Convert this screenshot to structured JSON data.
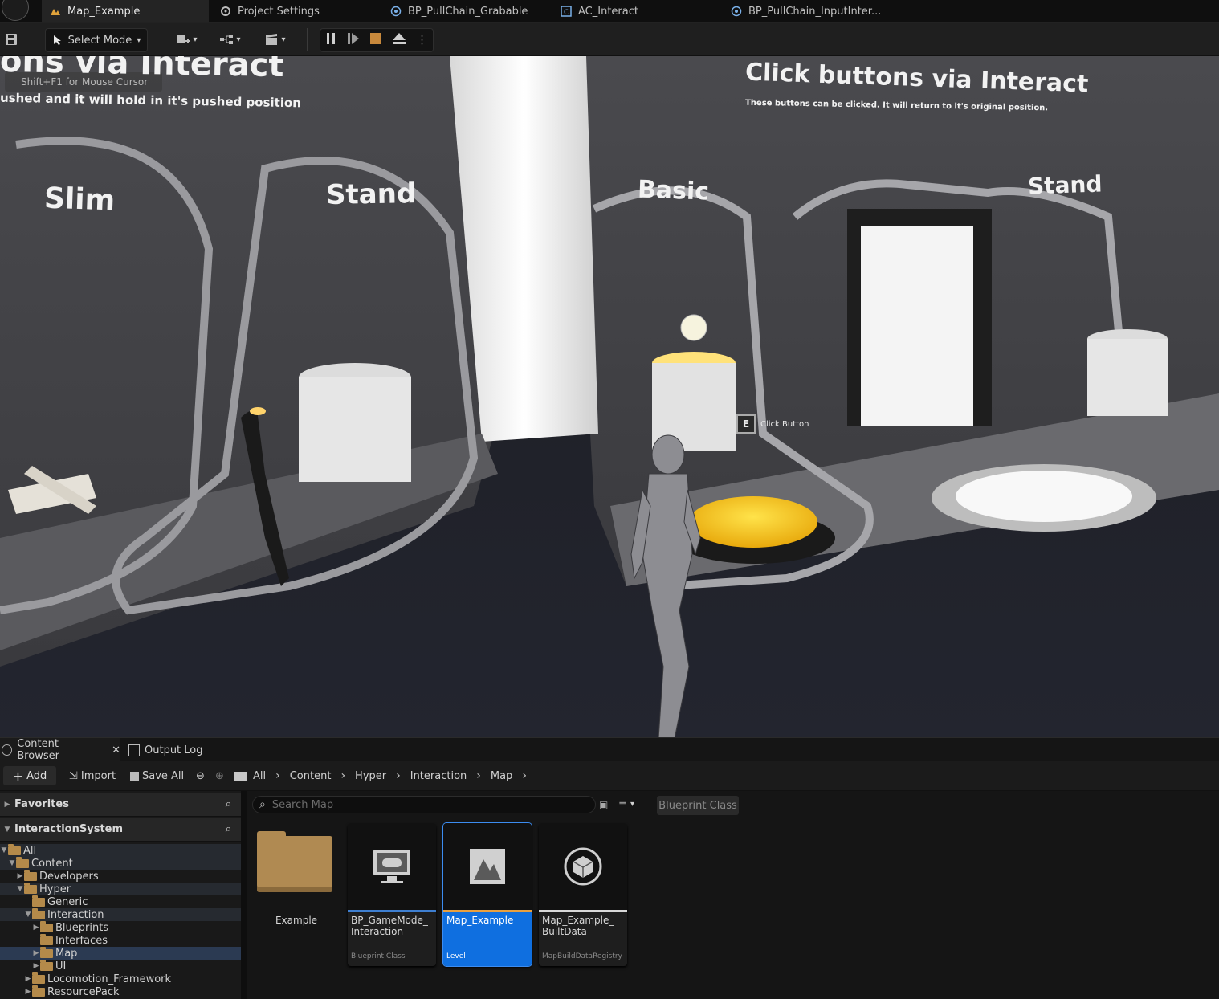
{
  "tabs": [
    {
      "label": "Map_Example",
      "icon": "level-icon",
      "active": true
    },
    {
      "label": "Project Settings",
      "icon": "settings-icon",
      "active": false
    },
    {
      "label": "BP_PullChain_Grabable",
      "icon": "blueprint-icon",
      "active": false
    },
    {
      "label": "AC_Interact",
      "icon": "component-icon",
      "active": false
    },
    {
      "label": "BP_PullChain_InputInter...",
      "icon": "blueprint-icon",
      "active": false
    }
  ],
  "toolbar": {
    "select_mode": "Select Mode"
  },
  "viewport": {
    "cursor_hint": "Shift+F1 for Mouse Cursor",
    "left_heading": "ons via Interact",
    "left_subheading": "ushed and it will hold in it's pushed position",
    "right_heading": "Click buttons via Interact",
    "right_subheading": "These buttons can be clicked. It will return to it's original position.",
    "booths": [
      "Slim",
      "Stand",
      "Basic",
      "Stand"
    ],
    "prompt_key": "E",
    "prompt_text": "Click Button"
  },
  "content_browser": {
    "tab_label": "Content Browser",
    "output_log_label": "Output Log",
    "add_label": "Add",
    "import_label": "Import",
    "save_all_label": "Save All",
    "breadcrumbs": [
      "All",
      "Content",
      "Hyper",
      "Interaction",
      "Map"
    ],
    "favorites_label": "Favorites",
    "project_label": "InteractionSystem",
    "search_placeholder": "Search Map",
    "filter_chip": "Blueprint Class",
    "tree": [
      {
        "label": "All",
        "expanded": true
      },
      {
        "label": "Content",
        "expanded": true
      },
      {
        "label": "Developers",
        "expanded": false
      },
      {
        "label": "Hyper",
        "expanded": true
      },
      {
        "label": "Generic",
        "expanded": false
      },
      {
        "label": "Interaction",
        "expanded": true
      },
      {
        "label": "Blueprints",
        "expanded": false
      },
      {
        "label": "Interfaces",
        "expanded": false
      },
      {
        "label": "Map",
        "expanded": false
      },
      {
        "label": "UI",
        "expanded": false
      },
      {
        "label": "Locomotion_Framework",
        "expanded": false
      },
      {
        "label": "ResourcePack",
        "expanded": false
      }
    ],
    "assets": [
      {
        "name": "Example",
        "type": "",
        "kind": "folder"
      },
      {
        "name": "BP_GameMode_\nInteraction",
        "type": "Blueprint Class",
        "kind": "blueprint"
      },
      {
        "name": "Map_Example",
        "type": "Level",
        "kind": "level"
      },
      {
        "name": "Map_Example_\nBuiltData",
        "type": "MapBuildDataRegistry",
        "kind": "data"
      }
    ]
  },
  "colors": {
    "accent": "#0f6fe0",
    "button_yellow": "#f5c31a",
    "folder": "#b48a4a"
  }
}
